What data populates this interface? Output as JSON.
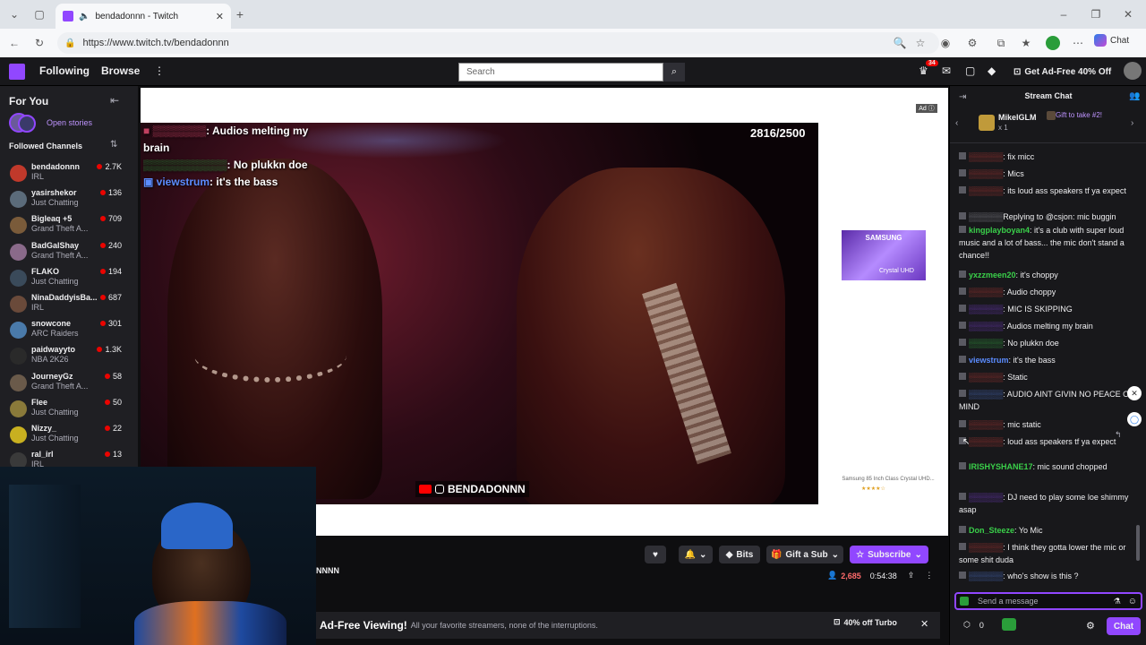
{
  "browser": {
    "tab_title": "bendadonnn - Twitch",
    "url": "https://www.twitch.tv/bendadonnn",
    "chat_label": "Chat"
  },
  "topnav": {
    "following": "Following",
    "browse": "Browse",
    "search_placeholder": "Search",
    "notification_count": "34",
    "ad_free": "Get Ad-Free 40% Off"
  },
  "sidebar": {
    "for_you": "For You",
    "open_stories": "Open stories",
    "followed_channels": "Followed Channels",
    "channels": [
      {
        "name": "bendadonnn",
        "game": "IRL",
        "viewers": "2.7K",
        "color": "#c0392b"
      },
      {
        "name": "yasirshekor",
        "game": "Just Chatting",
        "viewers": "136",
        "color": "#5b6b7a"
      },
      {
        "name": "Bigleaq +5",
        "game": "Grand Theft A...",
        "viewers": "709",
        "color": "#7a5b3a"
      },
      {
        "name": "BadGalShay",
        "game": "Grand Theft A...",
        "viewers": "240",
        "color": "#8a6a8a"
      },
      {
        "name": "FLAKO",
        "game": "Just Chatting",
        "viewers": "194",
        "color": "#3a4a5a"
      },
      {
        "name": "NinaDaddyisBa...",
        "game": "IRL",
        "viewers": "687",
        "color": "#6a4a3a"
      },
      {
        "name": "snowcone",
        "game": "ARC Raiders",
        "viewers": "301",
        "color": "#4a7aaa"
      },
      {
        "name": "paidwayyto",
        "game": "NBA 2K26",
        "viewers": "1.3K",
        "color": "#2a2a2a"
      },
      {
        "name": "JourneyGz",
        "game": "Grand Theft A...",
        "viewers": "58",
        "color": "#6a5a4a"
      },
      {
        "name": "Flee",
        "game": "Just Chatting",
        "viewers": "50",
        "color": "#8a7a3a"
      },
      {
        "name": "Nizzy_",
        "game": "Just Chatting",
        "viewers": "22",
        "color": "#c8b020"
      },
      {
        "name": "ral_irl",
        "game": "IRL",
        "viewers": "13",
        "color": "#3a3a3a"
      }
    ]
  },
  "video": {
    "goal_counter": "2816/2500",
    "overlay_msgs": [
      {
        "user": "",
        "text": ": Audios melting my brain"
      },
      {
        "user": "",
        "text": ": No plukkn doe"
      },
      {
        "user": "viewstrum",
        "text": ": it's the bass"
      }
    ],
    "watermark": "BENDADONNN",
    "ad_badge": "Ad",
    "ad_brand": "SAMSUNG",
    "ad_product": "Crystal UHD",
    "ad_caption": "Samsung 85 Inch Class Crystal UHD..."
  },
  "stream_bar": {
    "channel_name": "NNNN",
    "bits": "Bits",
    "gift": "Gift a Sub",
    "subscribe": "Subscribe",
    "viewers": "2,685",
    "uptime": "0:54:38",
    "promo_bold": "Ad-Free Viewing!",
    "promo_text": "All your favorite streamers, none of the interruptions.",
    "promo_btn": "40% off Turbo"
  },
  "chat": {
    "header": "Stream Chat",
    "pinned_user": "MikelGLM",
    "pinned_action": "Gift to take #2!",
    "pinned_count": "x 1",
    "messages": [
      {
        "user": "",
        "color": "#e0403a",
        "text": ": fix micc"
      },
      {
        "user": "",
        "color": "#e0403a",
        "text": ": Mics"
      },
      {
        "user": "",
        "color": "#e0403a",
        "text": ": its loud ass speakers tf ya expect"
      },
      {
        "user": "",
        "color": "#adadb8",
        "text": "Replying to @csjon: mic buggin"
      },
      {
        "user": "kingplayboyan4",
        "color": "#3ad04a",
        "text": ": it's a club with super loud music and a lot of bass... the mic don't stand a chance!!"
      },
      {
        "user": "yxzzmeen20",
        "color": "#3ad04a",
        "text": ": it's choppy"
      },
      {
        "user": "",
        "color": "#e0403a",
        "text": ": Audio choppy"
      },
      {
        "user": "",
        "color": "#9147ff",
        "text": ": MIC IS SKIPPING"
      },
      {
        "user": "",
        "color": "#9147ff",
        "text": ": Audios melting my brain"
      },
      {
        "user": "",
        "color": "#3ad04a",
        "text": ": No plukkn doe"
      },
      {
        "user": "viewstrum",
        "color": "#5b8cff",
        "text": ": it's the bass"
      },
      {
        "user": "",
        "color": "#e0403a",
        "text": ": Static"
      },
      {
        "user": "",
        "color": "#5b8cff",
        "text": ": AUDIO AINT GIVIN NO PEACE O MIND"
      },
      {
        "user": "",
        "color": "#e0403a",
        "text": ": mic static"
      },
      {
        "user": "",
        "color": "#e0403a",
        "text": ": loud ass speakers tf ya expect"
      },
      {
        "user": "IRISHYSHANE17",
        "color": "#3ad04a",
        "text": ": mic sound chopped"
      },
      {
        "user": "",
        "color": "#9147ff",
        "text": ": DJ need to play some loe shimmy asap"
      },
      {
        "user": "Don_Steeze",
        "color": "#3ad04a",
        "text": ": Yo Mic"
      },
      {
        "user": "",
        "color": "#e0403a",
        "text": ": I think they gotta lower the mic or some shit duda"
      },
      {
        "user": "",
        "color": "#5b8cff",
        "text": ": who's show is this ?"
      }
    ],
    "input_placeholder": "Send a message",
    "points": "0",
    "chat_button": "Chat"
  },
  "colors": {
    "accent": "#9147ff",
    "live": "#eb0400",
    "bg": "#0e0e10"
  }
}
